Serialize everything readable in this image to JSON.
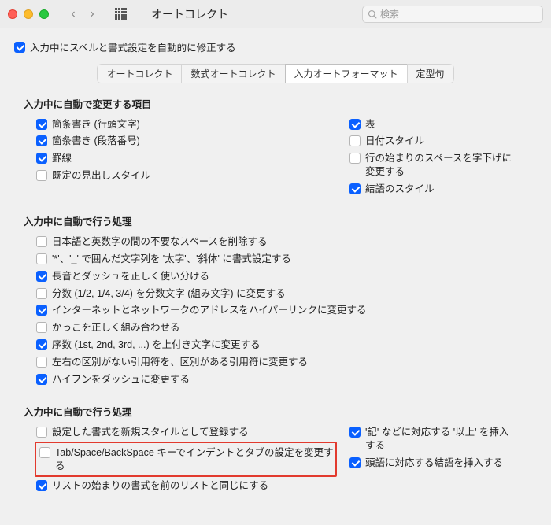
{
  "window": {
    "title": "オートコレクト",
    "search_placeholder": "検索"
  },
  "master": {
    "label": "入力中にスペルと書式設定を自動的に修正する",
    "checked": true
  },
  "tabs": [
    {
      "label": "オートコレクト",
      "active": false
    },
    {
      "label": "数式オートコレクト",
      "active": false
    },
    {
      "label": "入力オートフォーマット",
      "active": true
    },
    {
      "label": "定型句",
      "active": false
    }
  ],
  "sections": {
    "autoReplace": {
      "heading": "入力中に自動で変更する項目",
      "left": [
        {
          "label": "箇条書き (行頭文字)",
          "checked": true
        },
        {
          "label": "箇条書き (段落番号)",
          "checked": true
        },
        {
          "label": "罫線",
          "checked": true
        },
        {
          "label": "既定の見出しスタイル",
          "checked": false
        }
      ],
      "right": [
        {
          "label": "表",
          "checked": true
        },
        {
          "label": "日付スタイル",
          "checked": false
        },
        {
          "label": "行の始まりのスペースを字下げに変更する",
          "checked": false
        },
        {
          "label": "結語のスタイル",
          "checked": true
        }
      ]
    },
    "autoApply1": {
      "heading": "入力中に自動で行う処理",
      "items": [
        {
          "label": "日本語と英数字の間の不要なスペースを削除する",
          "checked": false
        },
        {
          "label": "'*'、'_' で囲んだ文字列を '太字'、'斜体' に書式設定する",
          "checked": false
        },
        {
          "label": "長音とダッシュを正しく使い分ける",
          "checked": true
        },
        {
          "label": "分数 (1/2, 1/4, 3/4) を分数文字 (組み文字) に変更する",
          "checked": false
        },
        {
          "label": "インターネットとネットワークのアドレスをハイパーリンクに変更する",
          "checked": true
        },
        {
          "label": "かっこを正しく組み合わせる",
          "checked": false
        },
        {
          "label": "序数 (1st, 2nd, 3rd, ...) を上付き文字に変更する",
          "checked": true
        },
        {
          "label": "左右の区別がない引用符を、区別がある引用符に変更する",
          "checked": false
        },
        {
          "label": "ハイフンをダッシュに変更する",
          "checked": true
        }
      ]
    },
    "autoApply2": {
      "heading": "入力中に自動で行う処理",
      "left": [
        {
          "label": "設定した書式を新規スタイルとして登録する",
          "checked": false
        },
        {
          "label": "Tab/Space/BackSpace キーでインデントとタブの設定を変更する",
          "checked": false,
          "highlight": true
        },
        {
          "label": "リストの始まりの書式を前のリストと同じにする",
          "checked": true
        }
      ],
      "right": [
        {
          "label": "'記' などに対応する '以上' を挿入する",
          "checked": true
        },
        {
          "label": "頭語に対応する結語を挿入する",
          "checked": true
        }
      ]
    }
  }
}
